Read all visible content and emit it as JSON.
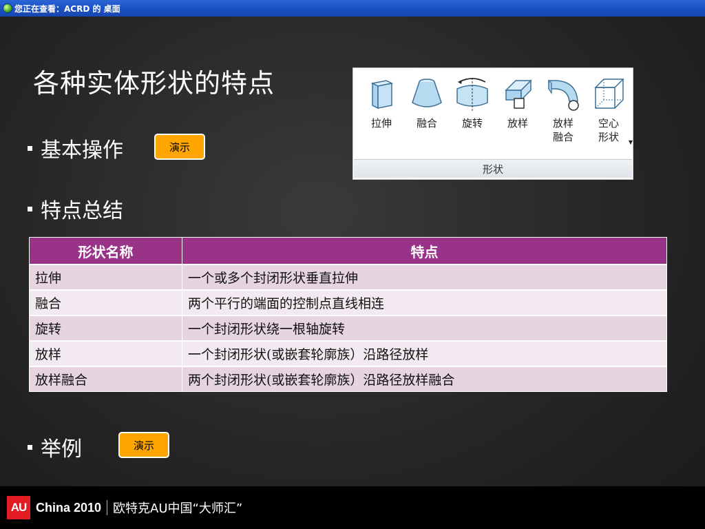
{
  "viewer": {
    "title": "您正在查看：ACRD 的 桌面"
  },
  "slide": {
    "title": "各种实体形状的特点",
    "bullets": {
      "basic_ops": "基本操作",
      "summary": "特点总结",
      "example": "举例"
    },
    "demo_label": "演示",
    "demo_button_color": "#ffa500"
  },
  "ribbon": {
    "tools": [
      {
        "label": "拉伸",
        "icon": "extrusion-icon"
      },
      {
        "label": "融合",
        "icon": "blend-icon"
      },
      {
        "label": "旋转",
        "icon": "revolve-icon"
      },
      {
        "label": "放样",
        "icon": "sweep-icon"
      },
      {
        "label": "放样\n融合",
        "icon": "swept-blend-icon"
      },
      {
        "label": "空心\n形状",
        "icon": "void-forms-icon"
      }
    ],
    "panel_label": "形状"
  },
  "table": {
    "headers": [
      "形状名称",
      "特点"
    ],
    "header_color": "#993388",
    "rows": [
      [
        "拉伸",
        "一个或多个封闭形状垂直拉伸"
      ],
      [
        "融合",
        "两个平行的端面的控制点直线相连"
      ],
      [
        "旋转",
        "一个封闭形状绕一根轴旋转"
      ],
      [
        "放样",
        "一个封闭形状(或嵌套轮廓族）沿路径放样"
      ],
      [
        "放样融合",
        "两个封闭形状(或嵌套轮廓族）沿路径放样融合"
      ]
    ]
  },
  "footer": {
    "logo": "AU",
    "brand": "China 2010",
    "tagline": "欧特克AU中国“大师汇”",
    "logo_color": "#e31b23"
  }
}
